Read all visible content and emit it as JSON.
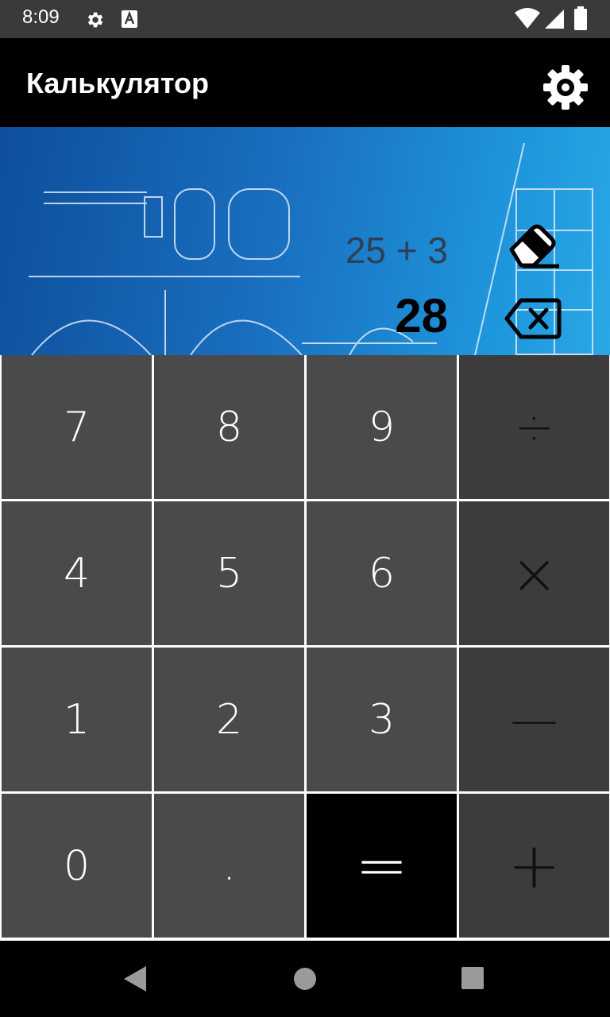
{
  "status_bar": {
    "time": "8:09",
    "icons": [
      "settings-icon",
      "font-icon",
      "wifi-icon",
      "signal-icon",
      "battery-icon"
    ]
  },
  "app_bar": {
    "title": "Калькулятор",
    "settings_icon": "gear-icon"
  },
  "display": {
    "expression": "25 + 3",
    "result": "28",
    "clear_icon": "eraser-icon",
    "backspace_icon": "backspace-icon"
  },
  "keypad": {
    "rows": [
      [
        {
          "label": "7",
          "kind": "digit"
        },
        {
          "label": "8",
          "kind": "digit"
        },
        {
          "label": "9",
          "kind": "digit"
        },
        {
          "label": "÷",
          "kind": "op",
          "icon": "divide-icon"
        }
      ],
      [
        {
          "label": "4",
          "kind": "digit"
        },
        {
          "label": "5",
          "kind": "digit"
        },
        {
          "label": "6",
          "kind": "digit"
        },
        {
          "label": "×",
          "kind": "op",
          "icon": "multiply-icon"
        }
      ],
      [
        {
          "label": "1",
          "kind": "digit"
        },
        {
          "label": "2",
          "kind": "digit"
        },
        {
          "label": "3",
          "kind": "digit"
        },
        {
          "label": "—",
          "kind": "op",
          "icon": "minus-icon"
        }
      ],
      [
        {
          "label": "0",
          "kind": "digit"
        },
        {
          "label": ".",
          "kind": "digit"
        },
        {
          "label": "=",
          "kind": "equals",
          "icon": "equals-icon"
        },
        {
          "label": "+",
          "kind": "op",
          "icon": "plus-icon"
        }
      ]
    ]
  },
  "nav_bar": {
    "buttons": [
      "back-icon",
      "home-icon",
      "recents-icon"
    ]
  },
  "colors": {
    "status_bar": "#3a3a3a",
    "app_bar": "#000000",
    "key_digit": "#4a4a4a",
    "key_operator": "#3d3b3b",
    "key_equals": "#000000",
    "nav_bar": "#000000"
  }
}
